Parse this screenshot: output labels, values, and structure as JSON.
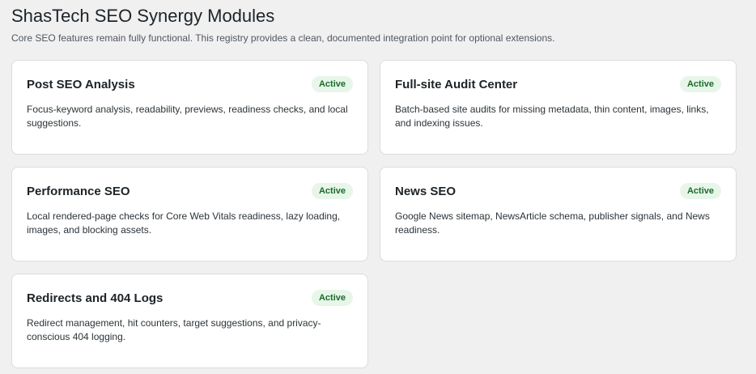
{
  "page": {
    "title": "ShasTech SEO Synergy Modules",
    "description": "Core SEO features remain fully functional. This registry provides a clean, documented integration point for optional extensions."
  },
  "colors": {
    "background": "#f0f0f1",
    "card": "#ffffff",
    "badge_bg": "#e7f6e9",
    "badge_text": "#1a6b2b"
  },
  "modules": [
    {
      "title": "Post SEO Analysis",
      "status": "Active",
      "description": "Focus-keyword analysis, readability, previews, readiness checks, and local suggestions."
    },
    {
      "title": "Full-site Audit Center",
      "status": "Active",
      "description": "Batch-based site audits for missing metadata, thin content, images, links, and indexing issues."
    },
    {
      "title": "Performance SEO",
      "status": "Active",
      "description": "Local rendered-page checks for Core Web Vitals readiness, lazy loading, images, and blocking assets."
    },
    {
      "title": "News SEO",
      "status": "Active",
      "description": "Google News sitemap, NewsArticle schema, publisher signals, and News readiness."
    },
    {
      "title": "Redirects and 404 Logs",
      "status": "Active",
      "description": "Redirect management, hit counters, target suggestions, and privacy-conscious 404 logging."
    }
  ]
}
